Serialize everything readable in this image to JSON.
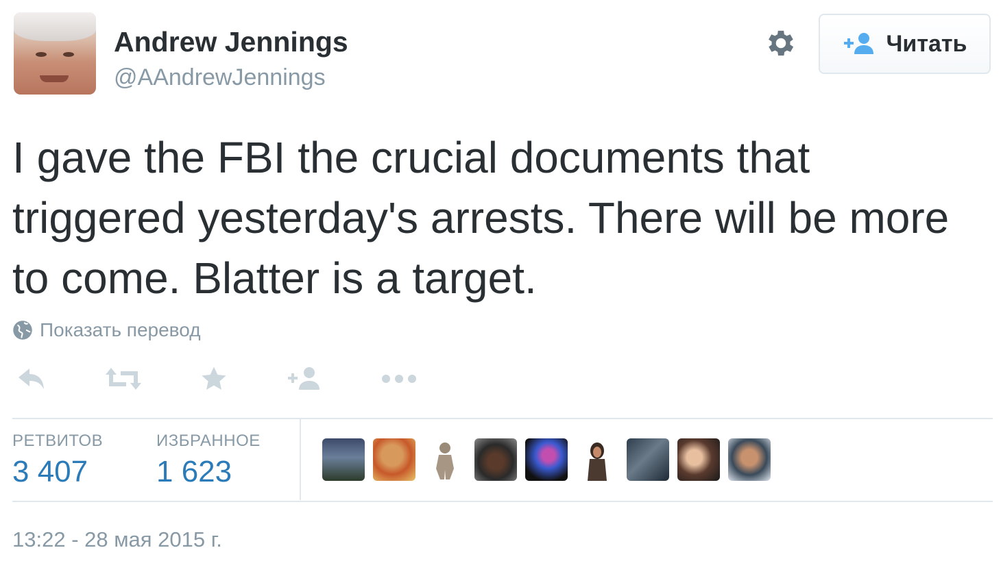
{
  "author": {
    "name": "Andrew Jennings",
    "handle": "@AAndrewJennings"
  },
  "follow_button": {
    "label": "Читать",
    "icon": "add-user-icon"
  },
  "tweet": {
    "text": "I gave the FBI the crucial documents that triggered yesterday's arrests. There will be more to come. Blatter is a target."
  },
  "translate_link": {
    "label": "Показать перевод",
    "icon": "globe-icon"
  },
  "actions": [
    "reply-icon",
    "retweet-icon",
    "favorite-icon",
    "follow-icon",
    "more-icon"
  ],
  "stats": {
    "retweets": {
      "label": "РЕТВИТОВ",
      "value": "3 407"
    },
    "favorites": {
      "label": "ИЗБРАННОЕ",
      "value": "1 623"
    }
  },
  "favorited_by_count": 9,
  "timestamp": "13:22 - 28 мая 2015 г.",
  "colors": {
    "text": "#292f33",
    "muted": "#8899a6",
    "link": "#2b7bb9",
    "accent": "#55acee",
    "border": "#e1e8ed"
  }
}
